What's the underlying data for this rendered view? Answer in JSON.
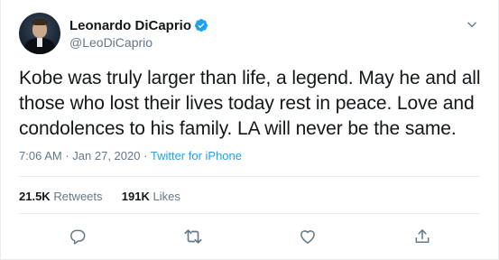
{
  "user": {
    "display_name": "Leonardo DiCaprio",
    "handle": "@LeoDiCaprio",
    "verified": true
  },
  "tweet": {
    "text": "Kobe was truly larger than life, a legend. May he and all those who lost their lives today rest in peace. Love and condolences to his family. LA will never be the same.",
    "time": "7:06 AM",
    "separator": "·",
    "date": "Jan 27, 2020",
    "source": "Twitter for iPhone"
  },
  "stats": {
    "retweets_count": "21.5K",
    "retweets_label": "Retweets",
    "likes_count": "191K",
    "likes_label": "Likes"
  },
  "icons": {
    "reply": "reply-icon",
    "retweet": "retweet-icon",
    "like": "like-icon",
    "share": "share-icon",
    "more": "chevron-down-icon",
    "verified": "verified-badge-icon"
  },
  "colors": {
    "accent": "#1da1f2",
    "secondary_text": "#657786",
    "border": "#e6ecf0"
  }
}
